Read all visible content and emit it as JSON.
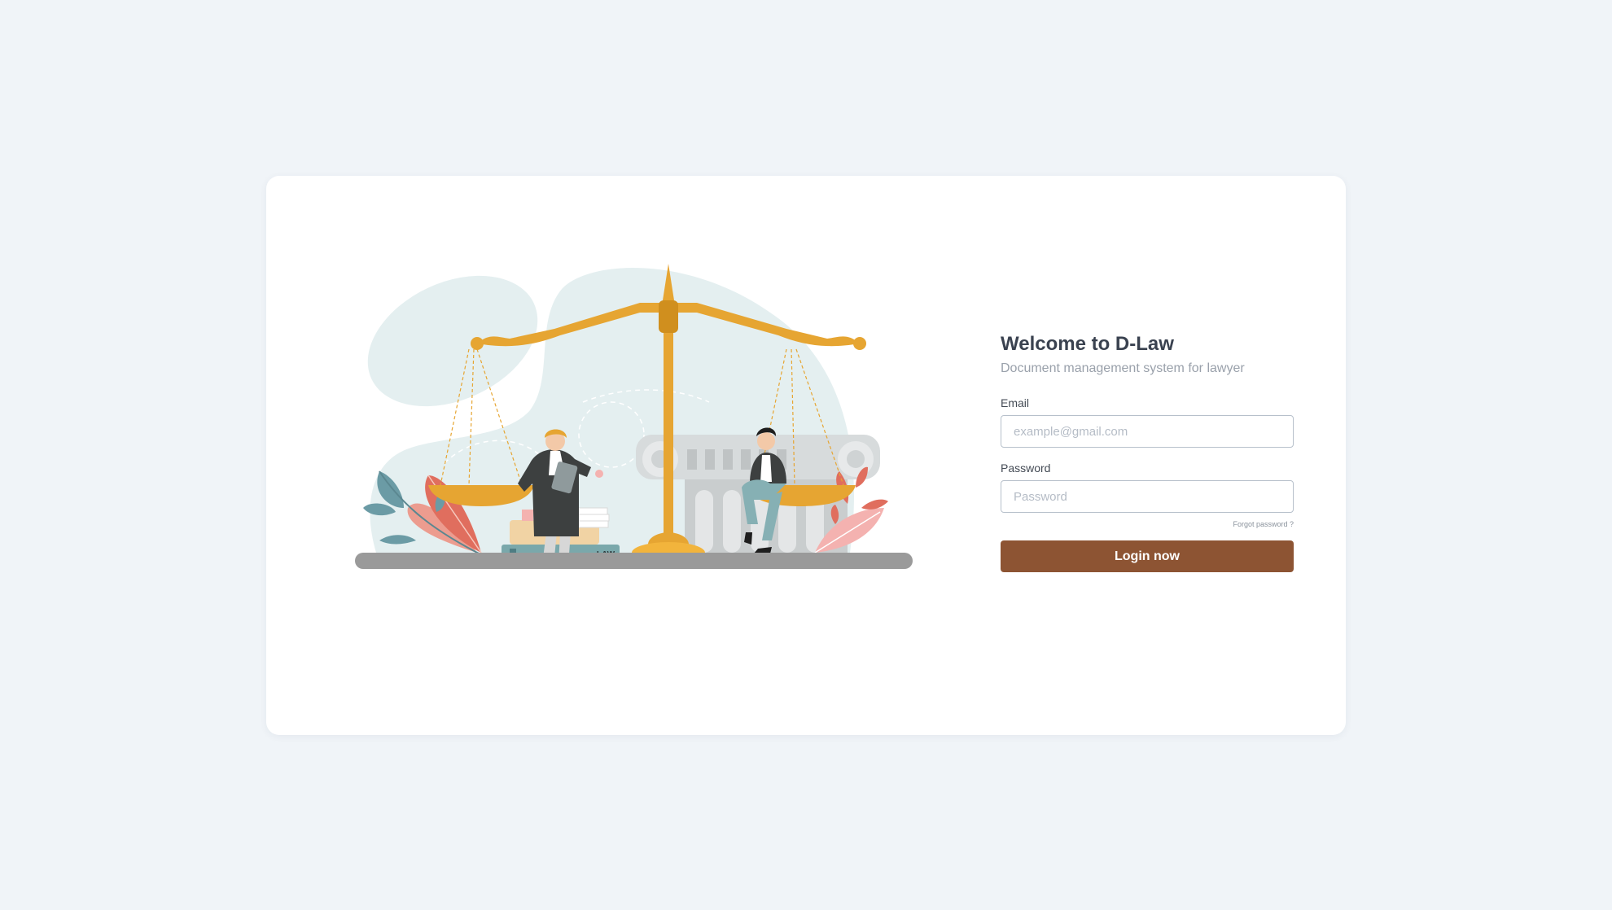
{
  "login": {
    "title": "Welcome to D-Law",
    "subtitle": "Document management system for lawyer",
    "email_label": "Email",
    "email_placeholder": "example@gmail.com",
    "email_value": "",
    "password_label": "Password",
    "password_placeholder": "Password",
    "password_value": "",
    "forgot_label": "Forgot password ?",
    "submit_label": "Login now"
  },
  "illustration": {
    "book_label": "LAW",
    "icons": [
      "scales-of-justice",
      "lawyer-figure",
      "client-figure",
      "column-pillar",
      "books",
      "leaves"
    ]
  },
  "colors": {
    "page_background": "#f0f4f8",
    "card_background": "#ffffff",
    "accent_button": "#8d5433",
    "scale_gold": "#e6a532"
  }
}
